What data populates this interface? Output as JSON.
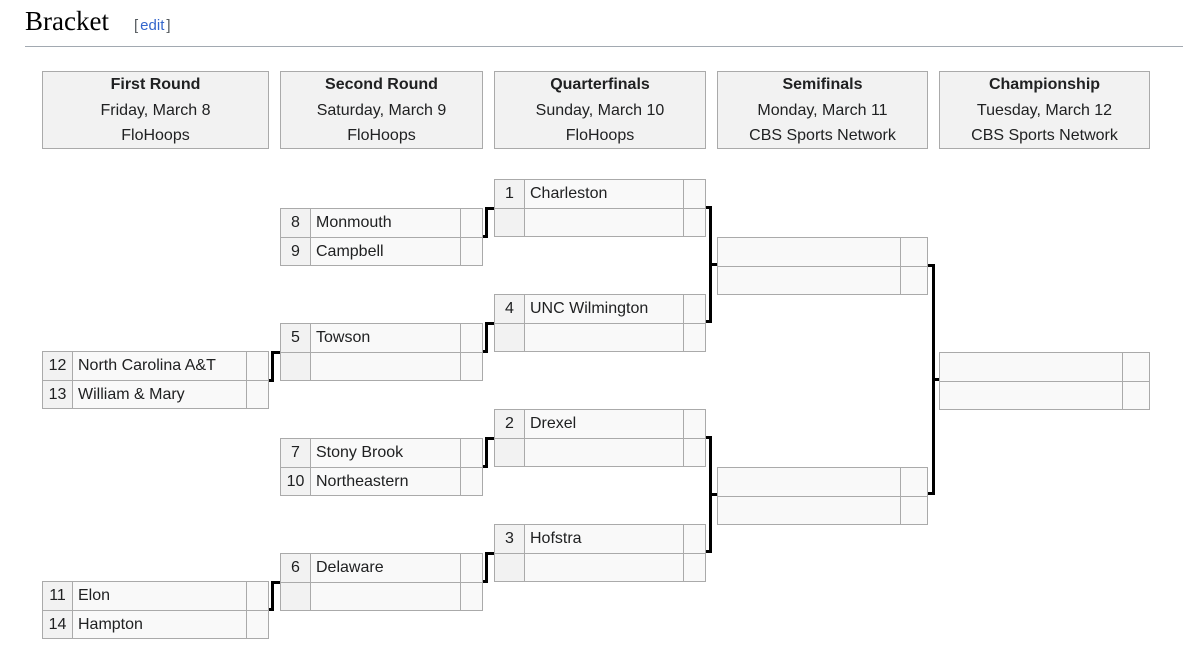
{
  "section": {
    "title": "Bracket",
    "edit_open": "[",
    "edit_label": "edit",
    "edit_close": "]"
  },
  "rounds": [
    {
      "title": "First Round",
      "date": "Friday, March 8",
      "network": "FloHoops"
    },
    {
      "title": "Second Round",
      "date": "Saturday, March 9",
      "network": "FloHoops"
    },
    {
      "title": "Quarterfinals",
      "date": "Sunday, March 10",
      "network": "FloHoops"
    },
    {
      "title": "Semifinals",
      "date": "Monday, March 11",
      "network": "CBS Sports Network"
    },
    {
      "title": "Championship",
      "date": "Tuesday, March 12",
      "network": "CBS Sports Network"
    }
  ],
  "first_round": [
    {
      "top": {
        "seed": "12",
        "team": "North Carolina A&T",
        "score": ""
      },
      "bottom": {
        "seed": "13",
        "team": "William & Mary",
        "score": ""
      }
    },
    {
      "top": {
        "seed": "11",
        "team": "Elon",
        "score": ""
      },
      "bottom": {
        "seed": "14",
        "team": "Hampton",
        "score": ""
      }
    }
  ],
  "second_round": [
    {
      "top": {
        "seed": "8",
        "team": "Monmouth",
        "score": ""
      },
      "bottom": {
        "seed": "9",
        "team": "Campbell",
        "score": ""
      }
    },
    {
      "top": {
        "seed": "5",
        "team": "Towson",
        "score": ""
      },
      "bottom": {
        "seed": "",
        "team": "",
        "score": ""
      }
    },
    {
      "top": {
        "seed": "7",
        "team": "Stony Brook",
        "score": ""
      },
      "bottom": {
        "seed": "10",
        "team": "Northeastern",
        "score": ""
      }
    },
    {
      "top": {
        "seed": "6",
        "team": "Delaware",
        "score": ""
      },
      "bottom": {
        "seed": "",
        "team": "",
        "score": ""
      }
    }
  ],
  "quarterfinals": [
    {
      "top": {
        "seed": "1",
        "team": "Charleston",
        "score": ""
      },
      "bottom": {
        "seed": "",
        "team": "",
        "score": ""
      }
    },
    {
      "top": {
        "seed": "4",
        "team": "UNC Wilmington",
        "score": ""
      },
      "bottom": {
        "seed": "",
        "team": "",
        "score": ""
      }
    },
    {
      "top": {
        "seed": "2",
        "team": "Drexel",
        "score": ""
      },
      "bottom": {
        "seed": "",
        "team": "",
        "score": ""
      }
    },
    {
      "top": {
        "seed": "3",
        "team": "Hofstra",
        "score": ""
      },
      "bottom": {
        "seed": "",
        "team": "",
        "score": ""
      }
    }
  ],
  "semifinals": [
    {
      "top": {
        "team": "",
        "score": ""
      },
      "bottom": {
        "team": "",
        "score": ""
      }
    },
    {
      "top": {
        "team": "",
        "score": ""
      },
      "bottom": {
        "team": "",
        "score": ""
      }
    }
  ],
  "championship": [
    {
      "top": {
        "team": "",
        "score": ""
      },
      "bottom": {
        "team": "",
        "score": ""
      }
    }
  ]
}
